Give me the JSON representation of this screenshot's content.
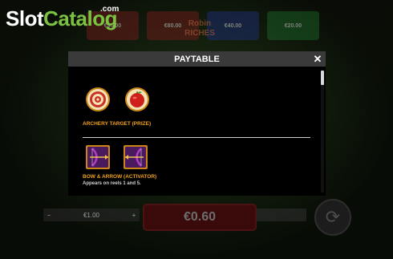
{
  "logo": {
    "part1": "Slot",
    "part2": "Catalog",
    "suffix": ".com"
  },
  "background": {
    "game_title_line1": "Robin",
    "game_title_line2": "RICHES",
    "jackpots": [
      "€35.00",
      "€80.00",
      "€40.00",
      "€20.00"
    ]
  },
  "paytable": {
    "title": "PAYTABLE",
    "close_symbol": "✕",
    "prize_symbol_label": "ARCHERY TARGET (PRIZE)",
    "activator_label": "BOW & ARROW (ACTIVATOR)",
    "activator_description": "Appears on reels 1 and 5."
  },
  "bottom_bar": {
    "bet_value": "€1.00",
    "minus_symbol": "−",
    "plus_symbol": "+",
    "win_value": "€0.60",
    "spin_symbol": "⟳"
  },
  "colors": {
    "accent_orange": "#f0a21a",
    "logo_green": "#7cc242",
    "modal_header": "#3a3a3a"
  },
  "icons": [
    "archery-target-icon",
    "apple-arrow-icon",
    "bow-arrow-left-icon",
    "bow-arrow-right-icon",
    "close-icon",
    "spin-icon"
  ]
}
